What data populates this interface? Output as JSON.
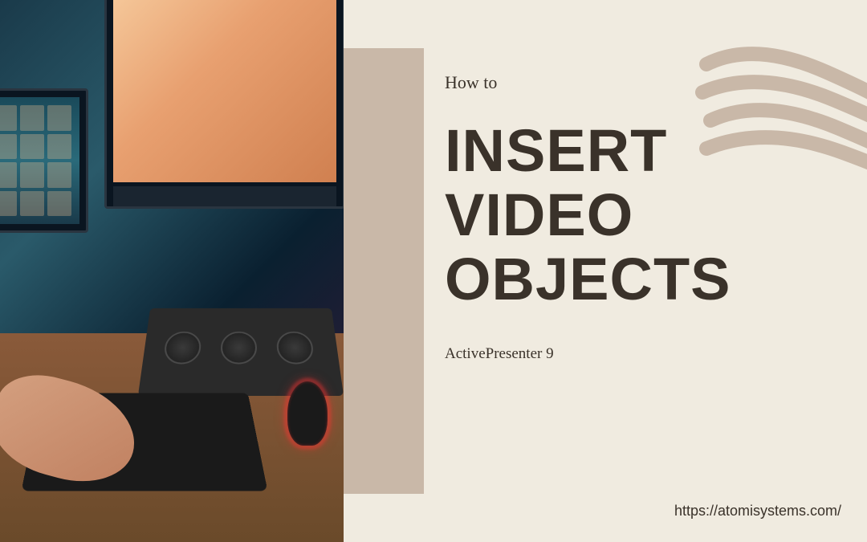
{
  "pretitle": "How to",
  "title_line1": "INSERT",
  "title_line2": "VIDEO",
  "title_line3": "OBJECTS",
  "subtitle": "ActivePresenter 9",
  "url": "https://atomisystems.com/",
  "colors": {
    "background": "#f0ebe0",
    "accent_block": "#c9b8a8",
    "text": "#3a322a",
    "scribble": "#c9b8a8"
  }
}
